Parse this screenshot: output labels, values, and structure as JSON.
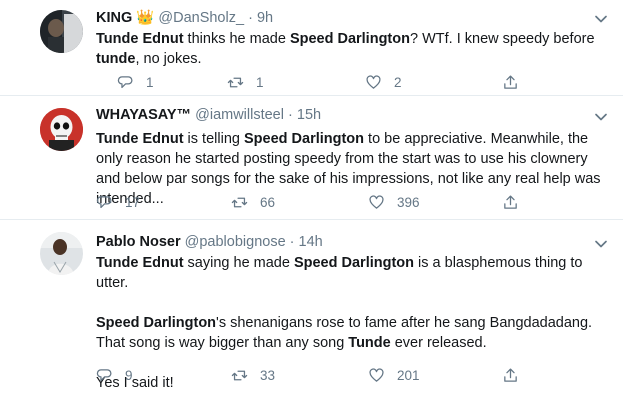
{
  "tweets": [
    {
      "name": "KING",
      "badge": "👑",
      "handle": "@DanSholz_",
      "separator": "·",
      "time": "9h",
      "text": [
        [
          {
            "t": "Tunde Ednut",
            "b": true
          },
          {
            "t": " thinks he made "
          },
          {
            "t": "Speed Darlington",
            "b": true
          },
          {
            "t": "? WTf. I knew speedy before "
          },
          {
            "t": "tunde",
            "b": true
          },
          {
            "t": ", no jokes."
          }
        ]
      ],
      "replies": "1",
      "retweets": "1",
      "likes": "2"
    },
    {
      "name": "WHAYASAY™",
      "badge": "",
      "handle": "@iamwillsteel",
      "separator": "·",
      "time": "15h",
      "text": [
        [
          {
            "t": "Tunde Ednut",
            "b": true
          },
          {
            "t": " is telling "
          },
          {
            "t": "Speed Darlington",
            "b": true
          },
          {
            "t": " to be appreciative. Meanwhile, the only reason he started posting speedy from the start was to use his clownery and below par songs for the sake of his impressions, not like any real help was intended..."
          }
        ]
      ],
      "replies": "17",
      "retweets": "66",
      "likes": "396"
    },
    {
      "name": "Pablo Noser",
      "badge": "",
      "handle": "@pablobignose",
      "separator": "·",
      "time": "14h",
      "text": [
        [
          {
            "t": "Tunde Ednut",
            "b": true
          },
          {
            "t": " saying he made "
          },
          {
            "t": "Speed Darlington",
            "b": true
          },
          {
            "t": " is a blasphemous thing to utter."
          }
        ],
        [
          {
            "t": "Speed Darlington",
            "b": true
          },
          {
            "t": "'s shenanigans rose to fame after he sang Bangdadadang. That song is way bigger than any song "
          },
          {
            "t": "Tunde",
            "b": true
          },
          {
            "t": " ever released."
          }
        ],
        [
          {
            "t": "Yes I said it!"
          }
        ]
      ],
      "replies": "9",
      "retweets": "33",
      "likes": "201"
    }
  ],
  "icons": {
    "reply": "reply-icon",
    "retweet": "retweet-icon",
    "like": "like-icon",
    "share": "share-icon",
    "caret": "chevron-down-icon"
  },
  "colors": {
    "icon_gray": "#657786",
    "divider": "#e6ecf0",
    "text": "#14171a"
  }
}
